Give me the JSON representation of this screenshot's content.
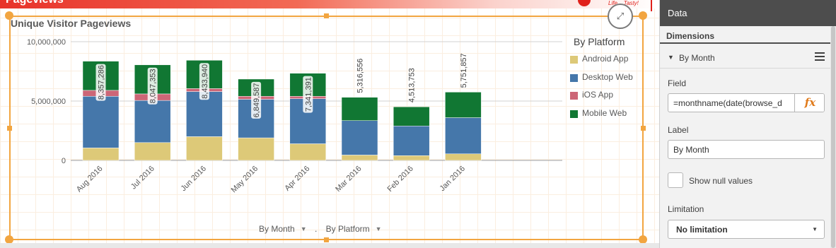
{
  "sheet": {
    "title": "Pageviews",
    "brand_text": "Life... Tasty!"
  },
  "chart": {
    "title": "Unique Visitor Pageviews",
    "legend_title": "By Platform",
    "footer": {
      "dim1": "By Month",
      "separator": ".",
      "dim2": "By Platform"
    }
  },
  "chart_data": {
    "type": "bar",
    "stacked": true,
    "title": "Unique Visitor Pageviews",
    "xlabel": "",
    "ylabel": "",
    "categories": [
      "Aug 2016",
      "Jul 2016",
      "Jun 2016",
      "May 2016",
      "Apr 2016",
      "Mar 2016",
      "Feb 2016",
      "Jan 2016"
    ],
    "series": [
      {
        "name": "Android App",
        "color": "#ddc978",
        "values": [
          1050000,
          1500000,
          2000000,
          1900000,
          1400000,
          450000,
          400000,
          550000
        ]
      },
      {
        "name": "Desktop Web",
        "color": "#4577aa",
        "values": [
          4350000,
          3550000,
          3800000,
          3250000,
          3800000,
          2900000,
          2500000,
          3050000
        ]
      },
      {
        "name": "iOS App",
        "color": "#cc6677",
        "values": [
          500000,
          550000,
          250000,
          250000,
          200000,
          0,
          0,
          0
        ]
      },
      {
        "name": "Mobile Web",
        "color": "#117733",
        "values": [
          2457286,
          2447353,
          2383940,
          1449587,
          1941391,
          1966556,
          1613753,
          2151857
        ]
      }
    ],
    "totals": [
      8357286,
      8047353,
      8433940,
      6849587,
      7341391,
      5316556,
      4513753,
      5751857
    ],
    "total_labels": [
      "8,357,286",
      "8,047,353",
      "8,433,940",
      "6,849,587",
      "7,341,391",
      "5,316,556",
      "4,513,753",
      "5,751,857"
    ],
    "y_ticks": [
      {
        "value": 10000000,
        "label": "10,000,000"
      },
      {
        "value": 5000000,
        "label": "5,000,000"
      },
      {
        "value": 0,
        "label": "0"
      }
    ],
    "ylim": [
      0,
      10000000
    ],
    "grid": true,
    "legend_position": "right"
  },
  "panel": {
    "header": "Data",
    "dimensions_label": "Dimensions",
    "dimension_name": "By Month",
    "field_label": "Field",
    "field_value": "=monthname(date(browse_d",
    "fx_label": "fx",
    "label_label": "Label",
    "label_value": "By Month",
    "show_null_label": "Show null values",
    "show_null_checked": false,
    "limitation_label": "Limitation",
    "limitation_value": "No limitation"
  },
  "icons": {
    "expand": "expand-arrows-icon",
    "dim_caret": "caret-down-icon",
    "menu": "hamburger-menu-icon",
    "select_caret": "caret-down-icon"
  }
}
